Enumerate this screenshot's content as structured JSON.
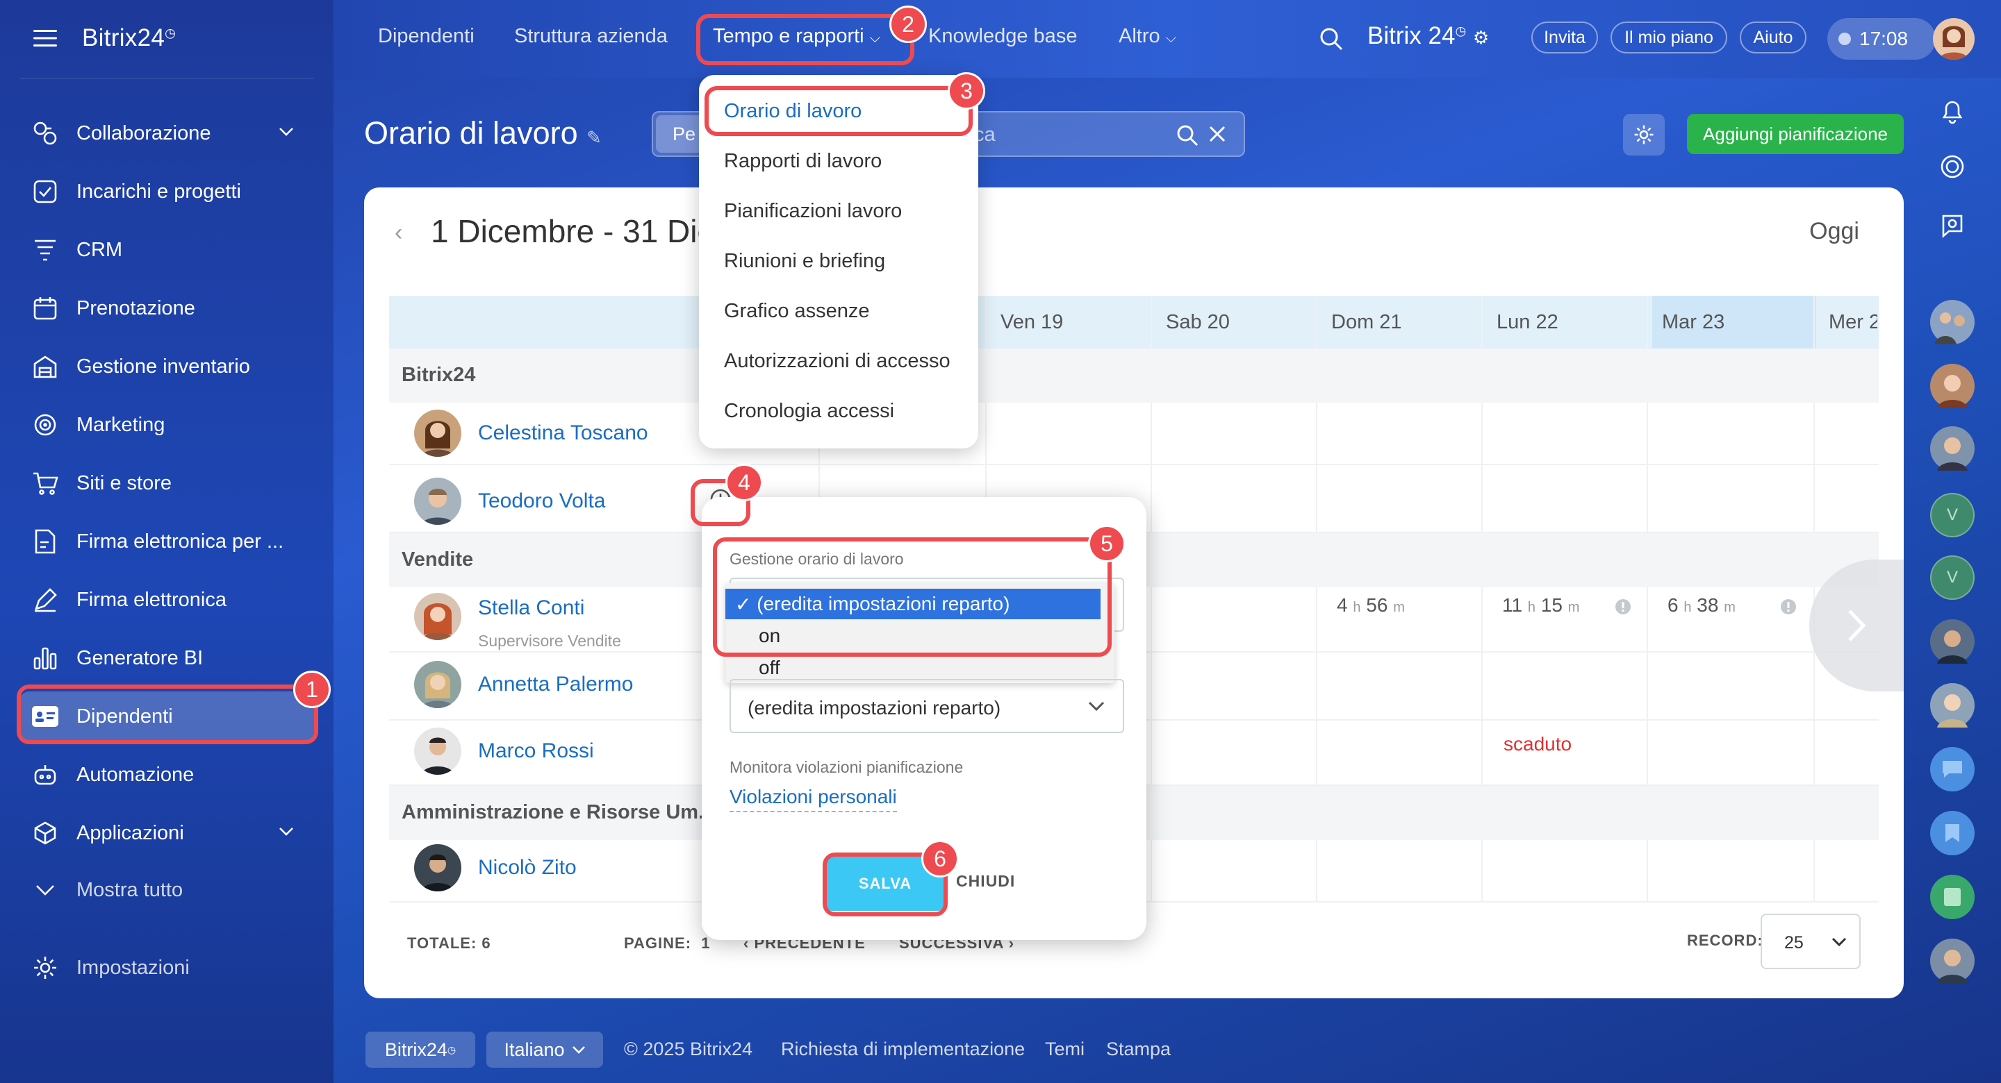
{
  "sidebar": {
    "logo": "Bitrix24",
    "items": [
      {
        "label": "Collaborazione",
        "icon": "chat-bubbles-icon"
      },
      {
        "label": "Incarichi e progetti",
        "icon": "checkbox-icon"
      },
      {
        "label": "CRM",
        "icon": "funnel-icon"
      },
      {
        "label": "Prenotazione",
        "icon": "calendar-icon"
      },
      {
        "label": "Gestione inventario",
        "icon": "warehouse-icon"
      },
      {
        "label": "Marketing",
        "icon": "target-icon"
      },
      {
        "label": "Siti e store",
        "icon": "cart-icon"
      },
      {
        "label": "Firma elettronica per ...",
        "icon": "document-sign-icon"
      },
      {
        "label": "Firma elettronica",
        "icon": "pen-icon"
      },
      {
        "label": "Generatore BI",
        "icon": "bar-chart-icon"
      },
      {
        "label": "Dipendenti",
        "icon": "id-card-icon"
      },
      {
        "label": "Automazione",
        "icon": "robot-icon"
      },
      {
        "label": "Applicazioni",
        "icon": "cube-icon"
      },
      {
        "label": "Mostra tutto",
        "icon": "chevron-down-icon"
      },
      {
        "label": "Impostazioni",
        "icon": "gear-icon"
      }
    ]
  },
  "topnav": {
    "items": [
      "Dipendenti",
      "Struttura azienda",
      "Tempo e rapporti",
      "Knowledge base",
      "Altro"
    ],
    "brand": "Bitrix 24",
    "invite": "Invita",
    "plan": "Il mio piano",
    "help": "Aiuto",
    "clock": "17:08"
  },
  "header": {
    "title": "Orario di lavoro",
    "filter_prefix": "Pe",
    "search_suffix": "ca",
    "add_button": "Aggiungi pianificazione"
  },
  "menu": {
    "items": [
      "Orario di lavoro",
      "Rapporti di lavoro",
      "Pianificazioni lavoro",
      "Riunioni e briefing",
      "Grafico assenze",
      "Autorizzazioni di accesso",
      "Cronologia accessi"
    ]
  },
  "calendar": {
    "period": "1 Dicembre - 31 Dic",
    "today": "Oggi",
    "days": [
      "Ven 19",
      "Sab 20",
      "Dom 21",
      "Lun 22",
      "Mar 23",
      "Mer 2"
    ],
    "sections": {
      "s1": "Bitrix24",
      "s2": "Vendite",
      "s3": "Amministrazione e Risorse Um."
    },
    "employees": [
      {
        "name": "Celestina Toscano"
      },
      {
        "name": "Teodoro Volta"
      },
      {
        "name": "Stella Conti",
        "role": "Supervisore Vendite"
      },
      {
        "name": "Annetta Palermo"
      },
      {
        "name": "Marco Rossi"
      },
      {
        "name": "Nicolò Zito"
      }
    ],
    "stella_times": {
      "dom_h": "4",
      "dom_m": "56",
      "lun_h": "11",
      "lun_m": "15",
      "mar_h": "6",
      "mar_m": "38",
      "h_unit": "h",
      "m_unit": "m"
    },
    "expired": "scaduto"
  },
  "footer": {
    "total_label": "TOTALE:",
    "total_value": "6",
    "pages_label": "PAGINE:",
    "pages_value": "1",
    "prev": "PRECEDENTE",
    "next": "SUCCESSIVA",
    "record_label": "RECORD:",
    "record_value": "25"
  },
  "popup": {
    "section_label": "Gestione orario di lavoro",
    "options": [
      "(eredita impostazioni reparto)",
      "on",
      "off"
    ],
    "second_select": "(eredita impostazioni reparto)",
    "violations_label": "Monitora violazioni pianificazione",
    "violations_link": "Violazioni personali",
    "save": "SALVA",
    "close": "CHIUDI"
  },
  "annotations": [
    "1",
    "2",
    "3",
    "4",
    "5",
    "6"
  ],
  "bottombar": {
    "logo": "Bitrix24",
    "language": "Italiano",
    "copyright": "© 2025 Bitrix24",
    "implementation": "Richiesta di implementazione",
    "themes": "Temi",
    "print": "Stampa"
  },
  "colors": {
    "accent_green": "#29b34a",
    "annotation_red": "#ef4a4f",
    "link_blue": "#1a6dc2",
    "save_cyan": "#3bc8f5",
    "expired_red": "#e0302f"
  }
}
